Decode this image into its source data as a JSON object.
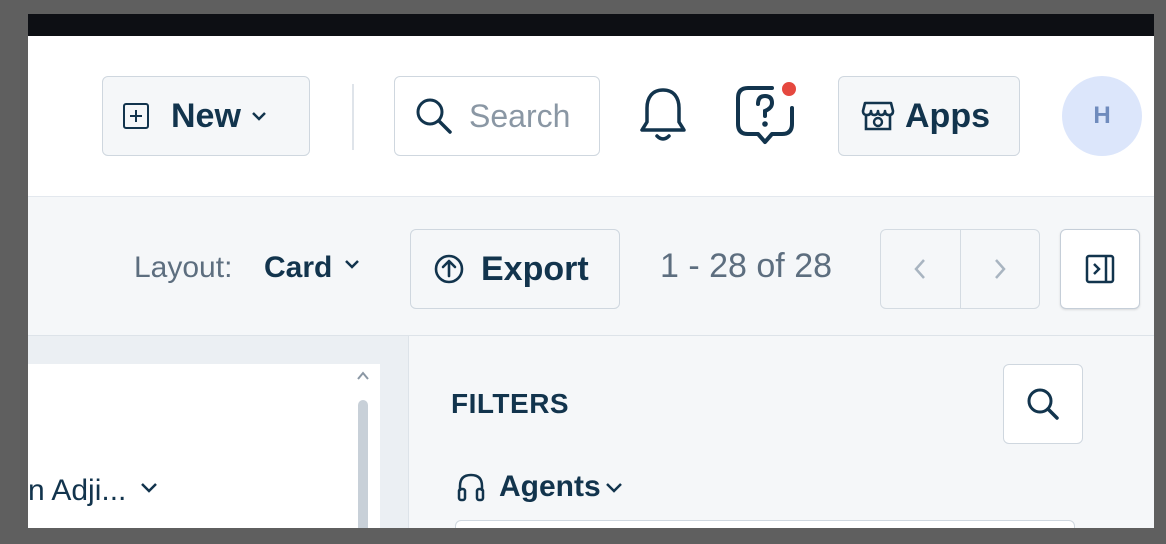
{
  "header": {
    "new_label": "New",
    "search_placeholder": "Search",
    "apps_label": "Apps",
    "avatar_initial": "H"
  },
  "toolbar": {
    "layout_label": "Layout:",
    "layout_value": "Card",
    "export_label": "Export",
    "pager_text": "1 - 28 of 28"
  },
  "list": {
    "card_text": "n Adji..."
  },
  "filters": {
    "title": "FILTERS",
    "agents_label": "Agents"
  },
  "colors": {
    "primary_text": "#12344d",
    "notification_dot": "#e5483f",
    "avatar_bg": "#dce6fb"
  }
}
